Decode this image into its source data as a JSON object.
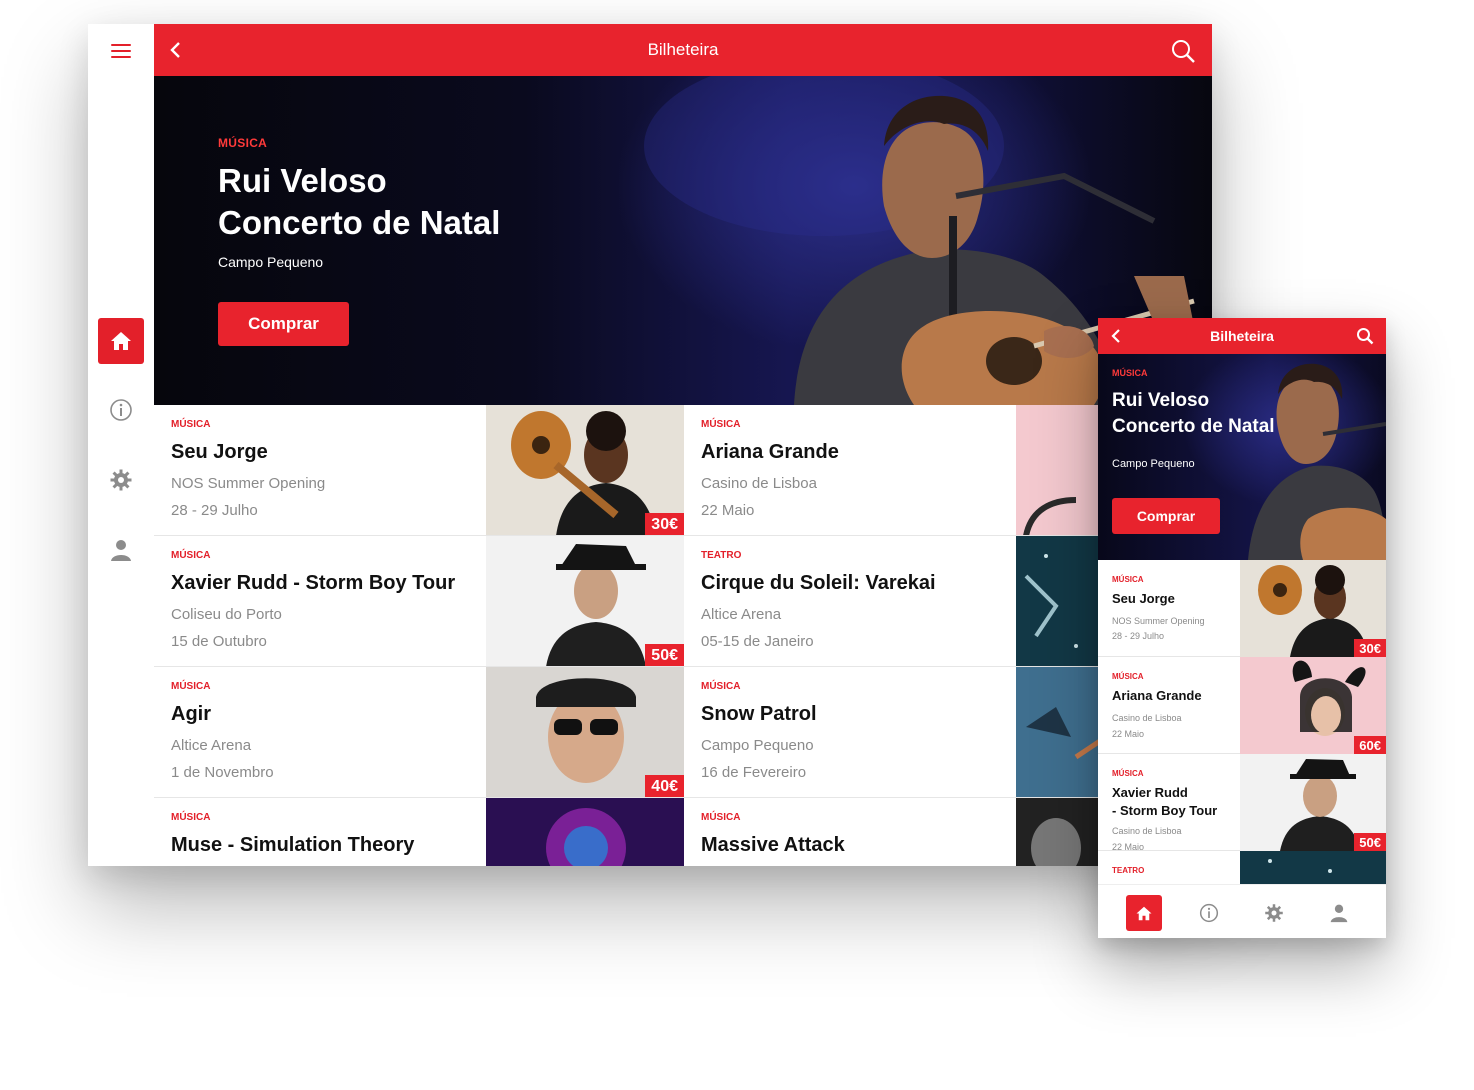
{
  "app": {
    "title": "Bilheteira"
  },
  "colors": {
    "accent": "#e8232d",
    "category": "#e3202a",
    "text": "#111111",
    "muted": "#8a8a8a"
  },
  "nav_icons": [
    "menu-icon",
    "home-icon",
    "info-icon",
    "gear-icon",
    "user-icon"
  ],
  "hero": {
    "category": "MÚSICA",
    "title_line1": "Rui Veloso",
    "title_line2": "Concerto de Natal",
    "venue": "Campo Pequeno",
    "button": "Comprar"
  },
  "tablet_events": [
    {
      "category": "MÚSICA",
      "title": "Seu Jorge",
      "venue": "NOS Summer Opening",
      "date": "28 - 29 Julho",
      "price": "30€"
    },
    {
      "category": "MÚSICA",
      "title": "Ariana Grande",
      "venue": "Casino de Lisboa",
      "date": "22 Maio"
    },
    {
      "category": "MÚSICA",
      "title": "Xavier Rudd - Storm Boy Tour",
      "venue": "Coliseu do Porto",
      "date": "15 de Outubro",
      "price": "50€"
    },
    {
      "category": "TEATRO",
      "title": "Cirque du Soleil: Varekai",
      "venue": "Altice Arena",
      "date": "05-15 de Janeiro"
    },
    {
      "category": "MÚSICA",
      "title": "Agir",
      "venue": "Altice Arena",
      "date": "1 de Novembro",
      "price": "40€"
    },
    {
      "category": "MÚSICA",
      "title": "Snow Patrol",
      "venue": "Campo Pequeno",
      "date": "16 de Fevereiro"
    },
    {
      "category": "MÚSICA",
      "title": "Muse - Simulation Theory"
    },
    {
      "category": "MÚSICA",
      "title": "Massive Attack"
    }
  ],
  "phone_events": [
    {
      "category": "MÚSICA",
      "title": "Seu Jorge",
      "venue": "NOS Summer Opening",
      "date": "28 - 29 Julho",
      "price": "30€"
    },
    {
      "category": "MÚSICA",
      "title": "Ariana Grande",
      "venue": "Casino de Lisboa",
      "date": "22 Maio",
      "price": "60€"
    },
    {
      "category": "MÚSICA",
      "title_line1": "Xavier Rudd",
      "title_line2": "- Storm Boy Tour",
      "venue": "Casino de Lisboa",
      "date": "22 Maio",
      "price": "50€"
    },
    {
      "category": "TEATRO"
    }
  ]
}
